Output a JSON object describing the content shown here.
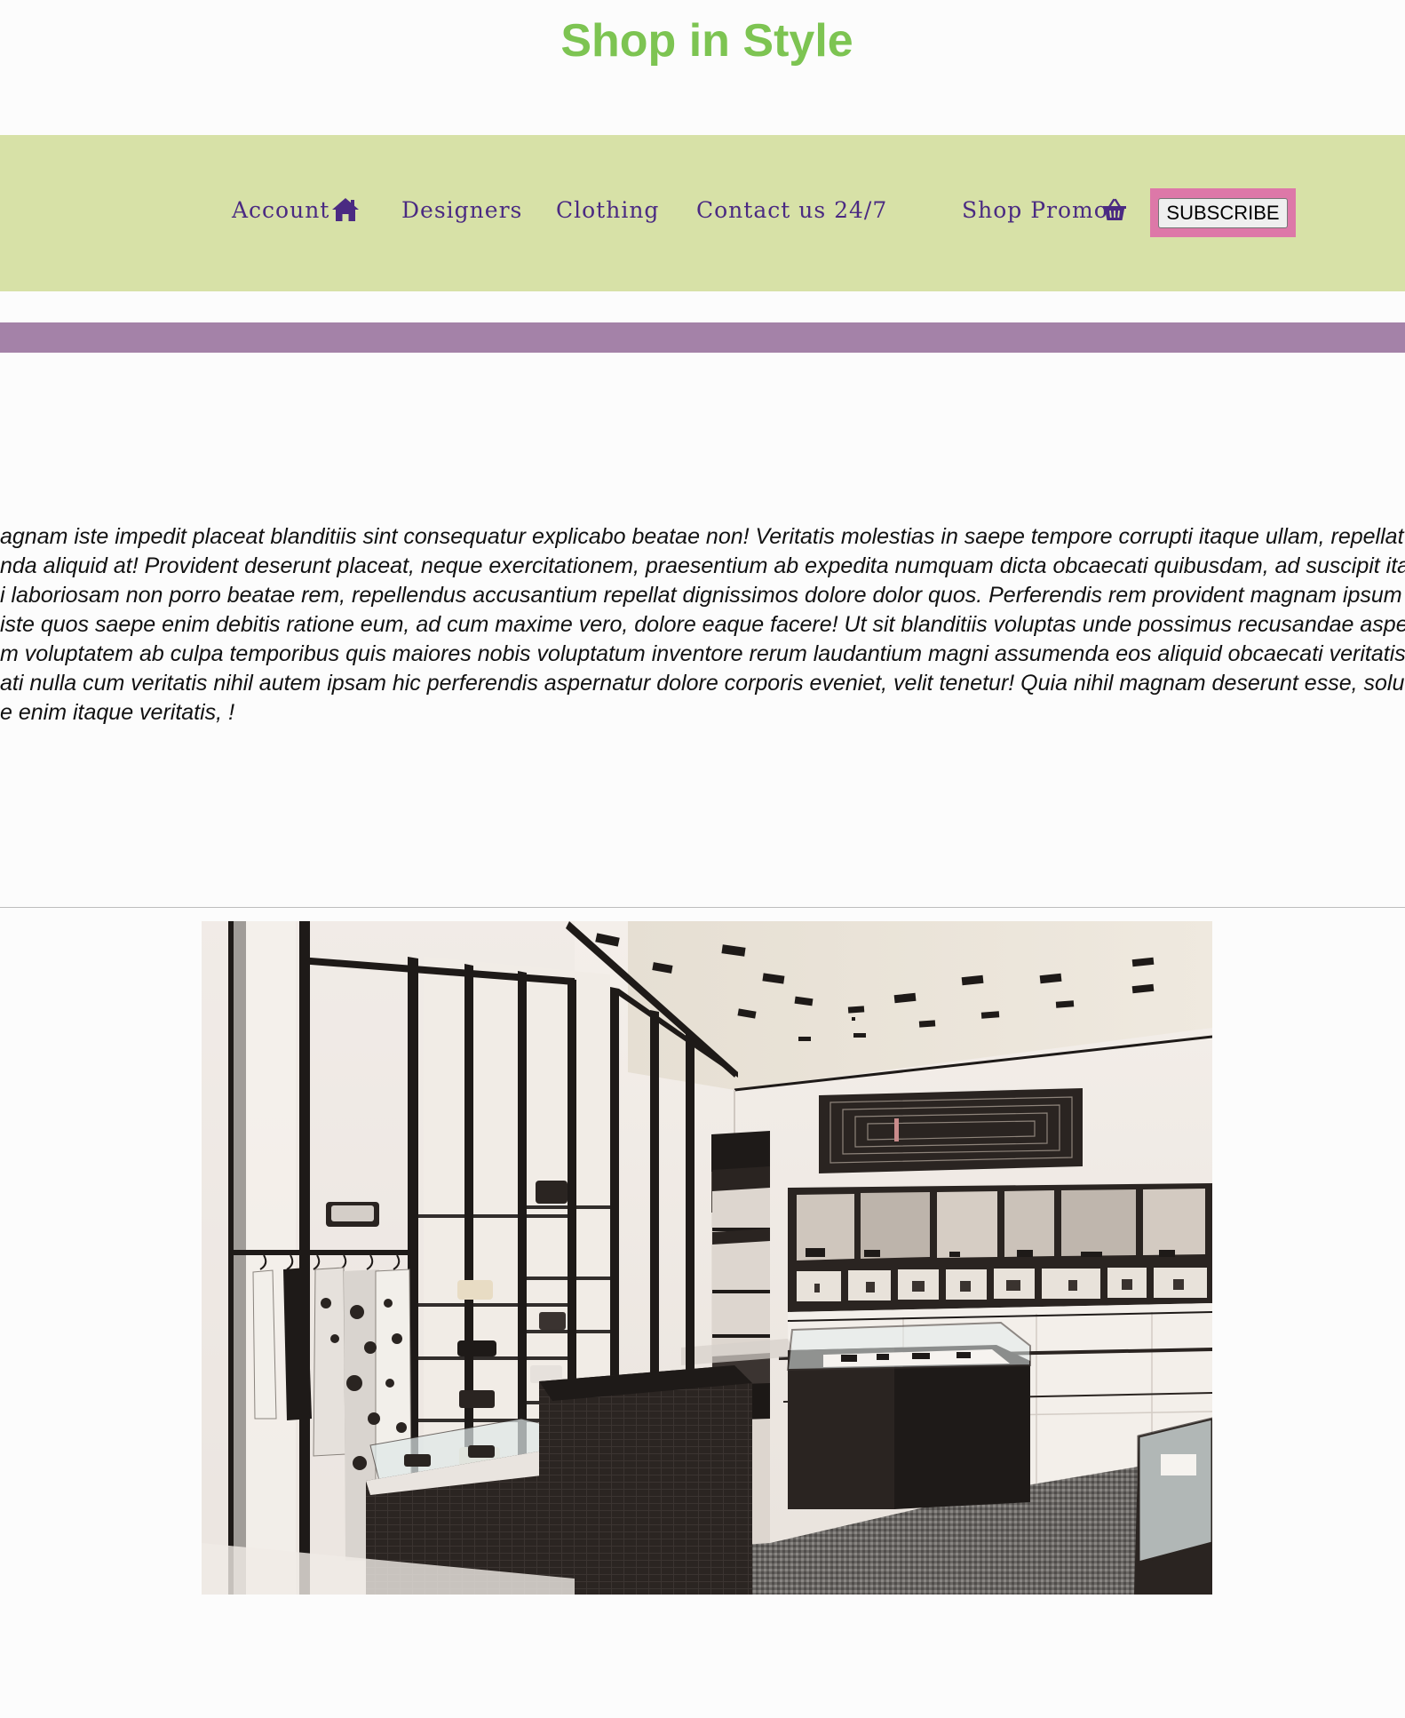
{
  "header": {
    "title": "Shop in Style"
  },
  "nav": {
    "account": "Account",
    "designers": "Designers",
    "clothing": "Clothing",
    "contact": "Contact us 24/7",
    "promo": "Shop Promo",
    "subscribe": "SUBSCRIBE"
  },
  "intro": {
    "lines": [
      "agnam iste impedit placeat blanditiis sint consequatur explicabo beatae non! Veritatis molestias in saepe tempore corrupti itaque ullam, repellat ea repud",
      "nda aliquid at! Provident deserunt placeat, neque exercitationem, praesentium ab expedita numquam dicta obcaecati quibusdam, ad suscipit itaque qua",
      "i laboriosam non porro beatae rem, repellendus accusantium repellat dignissimos dolore dolor quos. Perferendis rem provident magnam ipsum dignissir",
      "iste quos saepe enim debitis ratione eum, ad cum maxime vero, dolore eaque facere! Ut sit blanditiis voluptas unde possimus recusandae asperiores nu",
      "m voluptatem ab culpa temporibus quis maiores nobis voluptatum inventore rerum laudantium magni assumenda eos aliquid obcaecati veritatis nostrum",
      "ati nulla cum veritatis nihil autem ipsam hic perferendis aspernatur dolore corporis eveniet, velit tenetur! Quia nihil magnam deserunt esse, soluta aperiar",
      "e enim itaque veritatis, !"
    ]
  },
  "icons": {
    "account": "home-icon",
    "promo": "shopping-basket-icon"
  },
  "colors": {
    "title": "#7dc452",
    "nav_bg": "#d7e1a7",
    "nav_text": "#4a2a82",
    "accent_bar": "#a482a8",
    "subscribe_border": "#dd78a8"
  }
}
